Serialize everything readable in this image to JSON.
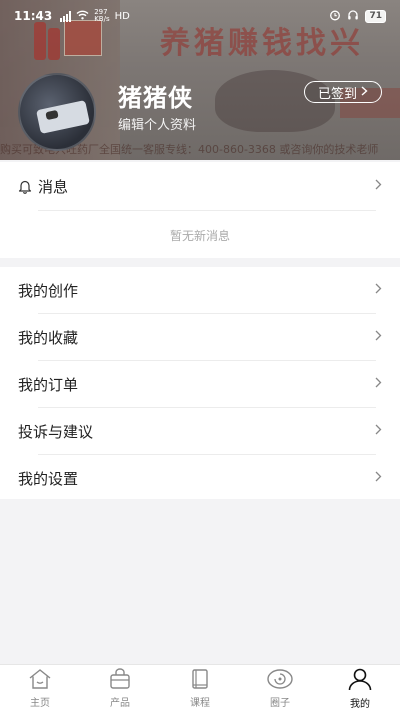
{
  "status": {
    "time": "11:43",
    "network": "HD",
    "speed_top": "297",
    "speed_unit": "KB/s",
    "battery": "71"
  },
  "header": {
    "banner_text": "养猪赚钱找兴",
    "marquee": "购买可致电兴旺药厂全国统一客服专线：400-860-3368 或咨询你的技术老师"
  },
  "profile": {
    "username": "猪猪侠",
    "edit_label": "编辑个人资料",
    "checkin_label": "已签到"
  },
  "messages": {
    "title": "消息",
    "empty_text": "暂无新消息"
  },
  "menu": {
    "items": [
      {
        "label": "我的创作"
      },
      {
        "label": "我的收藏"
      },
      {
        "label": "我的订单"
      },
      {
        "label": "投诉与建议"
      },
      {
        "label": "我的设置"
      }
    ]
  },
  "tabs": [
    {
      "label": "主页",
      "icon": "home-icon"
    },
    {
      "label": "产品",
      "icon": "bag-icon"
    },
    {
      "label": "课程",
      "icon": "book-icon"
    },
    {
      "label": "圈子",
      "icon": "circle-icon"
    },
    {
      "label": "我的",
      "icon": "person-icon",
      "active": true
    }
  ]
}
